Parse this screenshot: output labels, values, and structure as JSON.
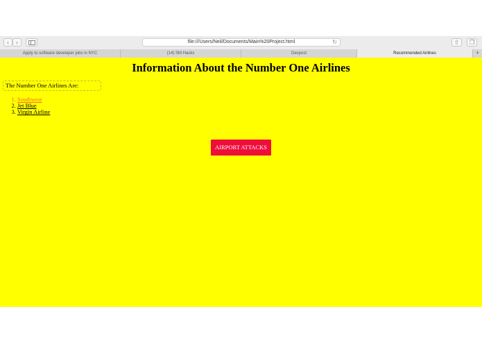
{
  "browser": {
    "address": "file:///Users/Neil/Documents/Main%20Project.html",
    "tabs": [
      {
        "label": "Apply to software developer jobs in NYC",
        "active": false
      },
      {
        "label": "(14) SM Hacks",
        "active": false
      },
      {
        "label": "Devpost",
        "active": false
      },
      {
        "label": "Recommended Airlines",
        "active": true
      }
    ],
    "new_tab_label": "+",
    "icons": [
      "chevron-left-icon",
      "chevron-right-icon",
      "sidebar-icon",
      "reload-icon",
      "share-icon",
      "tabs-overview-icon"
    ]
  },
  "page": {
    "background": "#ffff00",
    "title": "Information About the Number One Airlines",
    "intro": "The Number One Airlines Are:",
    "airlines": [
      {
        "name": "Southwest",
        "visited": true
      },
      {
        "name": "Jet Blue",
        "visited": false
      },
      {
        "name": "Virgin Airline",
        "visited": false
      }
    ],
    "button_label": "AIRPORT ATTACKS",
    "button_color": "#ee0e3a",
    "visited_link_color": "#ff6a2b"
  }
}
